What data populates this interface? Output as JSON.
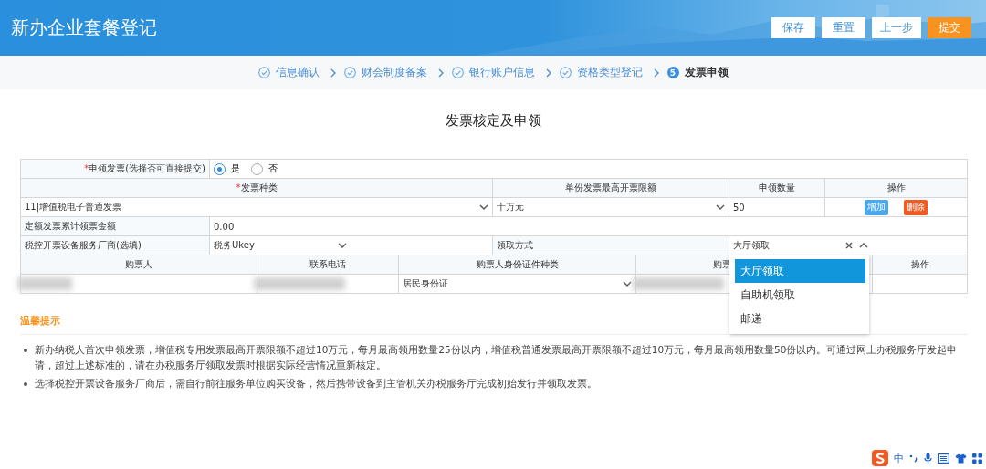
{
  "header": {
    "title": "新办企业套餐登记",
    "buttons": [
      {
        "label": "保存",
        "kind": "plain"
      },
      {
        "label": "重置",
        "kind": "plain"
      },
      {
        "label": "上一步",
        "kind": "plain"
      },
      {
        "label": "提交",
        "kind": "primary"
      }
    ]
  },
  "steps": [
    {
      "label": "信息确认",
      "completed": true
    },
    {
      "label": "财会制度备案",
      "completed": true
    },
    {
      "label": "银行账户信息",
      "completed": true
    },
    {
      "label": "资格类型登记",
      "completed": true
    },
    {
      "label": "发票申领",
      "completed": false,
      "number": "5"
    }
  ],
  "form_title": "发票核定及申领",
  "apply": {
    "required_mark": "*",
    "label": "申领发票(选择否可直接提交)",
    "options": [
      {
        "label": "是",
        "selected": true
      },
      {
        "label": "否",
        "selected": false
      }
    ]
  },
  "invoice_table": {
    "columns": [
      {
        "label": "发票种类",
        "required_mark": "*"
      },
      {
        "label": "单份发票最高开票限额"
      },
      {
        "label": "申领数量"
      },
      {
        "label": "操作"
      }
    ],
    "rows": [
      {
        "type": "11|增值税电子普通发票",
        "limit": "十万元",
        "quantity": "50",
        "actions": [
          {
            "label": "增加",
            "kind": "add"
          },
          {
            "label": "删除",
            "kind": "delete"
          }
        ]
      }
    ]
  },
  "total": {
    "label": "定额发票累计领票金额",
    "value": "0.00"
  },
  "vendor": {
    "label": "税控开票设备服务厂商(选填)",
    "value": "税务Ukey"
  },
  "pickup": {
    "label": "领取方式",
    "value": "大厅领取",
    "expanded": true,
    "options": [
      {
        "label": "大厅领取",
        "selected": true
      },
      {
        "label": "自助机领取",
        "selected": false
      },
      {
        "label": "邮递",
        "selected": false
      }
    ]
  },
  "buyer_table": {
    "columns": [
      "购票人",
      "联系电话",
      "购票人身份证件种类",
      "购票",
      "操作"
    ],
    "rows": [
      {
        "id_type": "居民身份证"
      }
    ]
  },
  "tips": {
    "title": "温馨提示",
    "items": [
      "新办纳税人首次申领发票，增值税专用发票最高开票限额不超过10万元，每月最高领用数量25份以内，增值税普通发票最高开票限额不超过10万元，每月最高领用数量50份以内。可通过网上办税服务厅发起申请，超过上述标准的，请在办税服务厅领取发票时根据实际经营情况重新核定。",
      "选择税控开票设备服务厂商后，需自行前往服务单位购买设备，然后携带设备到主管机关办税服务厅完成初始发行并领取发票。"
    ]
  },
  "ime_bar": {
    "mode": "中"
  }
}
